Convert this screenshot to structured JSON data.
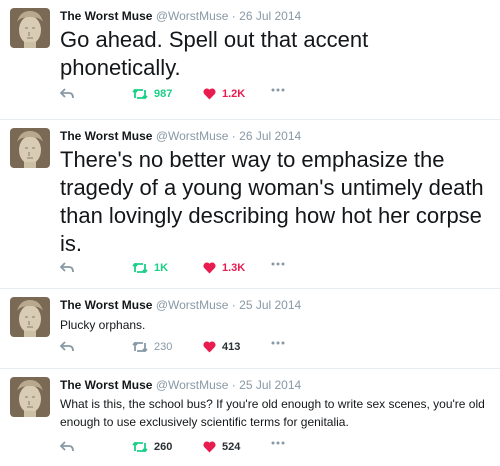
{
  "colors": {
    "retweet": "#19cf86",
    "like": "#e81c4f",
    "meta": "#8899a6",
    "text": "#14171a"
  },
  "tweets": [
    {
      "name": "The Worst Muse",
      "handle": "@WorstMuse",
      "date": "26 Jul 2014",
      "text": "Go ahead. Spell out that accent phonetically.",
      "retweets": "987",
      "likes": "1.2K"
    },
    {
      "name": "The Worst Muse",
      "handle": "@WorstMuse",
      "date": "26 Jul 2014",
      "text": "There's no better way to emphasize the tragedy of a young woman's untimely death than lovingly describing how hot her corpse is.",
      "retweets": "1K",
      "likes": "1.3K"
    },
    {
      "name": "The Worst Muse",
      "handle": "@WorstMuse",
      "date": "25 Jul 2014",
      "text": "Plucky orphans.",
      "retweets": "230",
      "likes": "413"
    },
    {
      "name": "The Worst Muse",
      "handle": "@WorstMuse",
      "date": "25 Jul 2014",
      "text": "What is this, the school bus? If you're old enough to write sex scenes, you're old enough to use exclusively scientific terms for genitalia.",
      "retweets": "260",
      "likes": "524"
    }
  ]
}
